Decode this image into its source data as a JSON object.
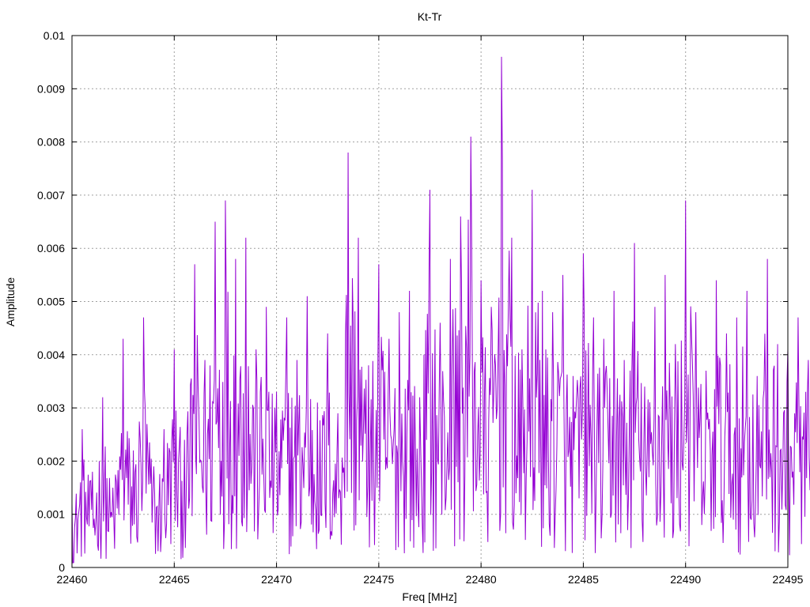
{
  "chart_data": {
    "type": "line",
    "title": "Kt-Tr",
    "xlabel": "Freq [MHz]",
    "ylabel": "Amplitude",
    "xlim": [
      22460,
      22495
    ],
    "ylim": [
      0,
      0.01
    ],
    "grid": true,
    "x_ticks": [
      "22460",
      "22465",
      "22470",
      "22475",
      "22480",
      "22485",
      "22490",
      "22495"
    ],
    "y_ticks": [
      "0",
      "0.001",
      "0.002",
      "0.003",
      "0.004",
      "0.005",
      "0.006",
      "0.007",
      "0.008",
      "0.009",
      "0.01"
    ],
    "series": [
      {
        "color": "#9400d3",
        "x_start": 22460,
        "x_step": 0.5,
        "values": [
          0.0012,
          0.0026,
          0.0018,
          0.0032,
          0.0015,
          0.0043,
          0.0022,
          0.0047,
          0.0019,
          0.0026,
          0.0041,
          0.0024,
          0.0057,
          0.0039,
          0.0065,
          0.0069,
          0.0058,
          0.0062,
          0.0041,
          0.0049,
          0.0033,
          0.0047,
          0.0039,
          0.0051,
          0.0031,
          0.0044,
          0.0029,
          0.0078,
          0.0062,
          0.0038,
          0.0057,
          0.0043,
          0.0048,
          0.0052,
          0.0032,
          0.0071,
          0.0046,
          0.0058,
          0.0066,
          0.0081,
          0.0054,
          0.0049,
          0.0096,
          0.0062,
          0.0041,
          0.0071,
          0.0052,
          0.0048,
          0.0055,
          0.0036,
          0.0059,
          0.0047,
          0.0043,
          0.0052,
          0.0039,
          0.0061,
          0.0034,
          0.0049,
          0.0055,
          0.0042,
          0.0069,
          0.0048,
          0.0037,
          0.0054,
          0.0044,
          0.0047,
          0.0052,
          0.0036,
          0.0058,
          0.0042,
          0.0041,
          0.0047,
          0.0039,
          0.0063,
          0.0034,
          0.0049,
          0.0028,
          0.0036,
          0.0046,
          0.0038,
          0.0043,
          0.0047,
          0.0033,
          0.0041,
          0.0037,
          0.0045,
          0.0039,
          0.0044,
          0.0031,
          0.0038,
          0.0042,
          0.0035,
          0.0041,
          0.0032,
          0.0043,
          0.0046,
          0.0064,
          0.0052,
          0.0037,
          0.0041,
          0.0044,
          0.0036,
          0.0042,
          0.0038,
          0.0041,
          0.0034,
          0.0029,
          0.0043,
          0.0037,
          0.0026,
          0.0024,
          0.0038,
          0.0031,
          0.0025,
          0.0022,
          0.0018,
          0.0016,
          0.0014,
          0.0015,
          0.0013,
          0.0014,
          0.0013,
          0.0016,
          0.0014,
          0.0015
        ]
      }
    ]
  }
}
